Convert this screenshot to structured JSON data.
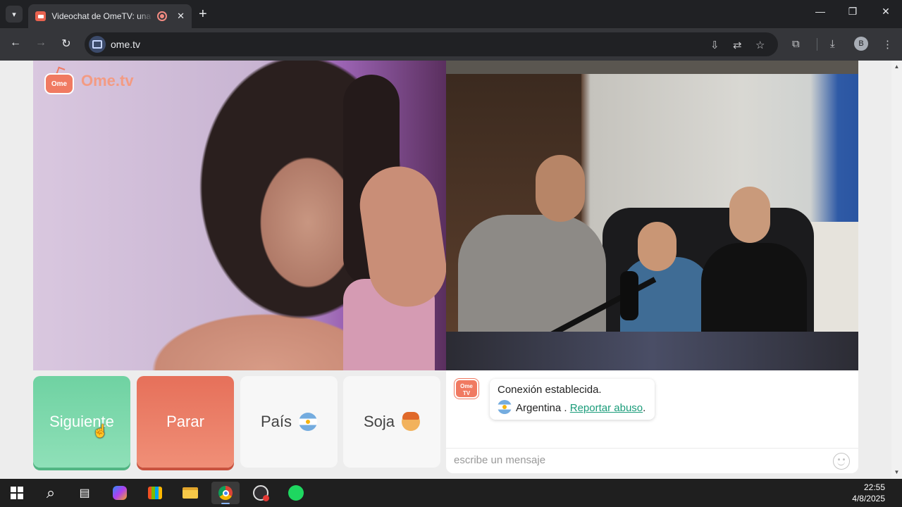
{
  "browser": {
    "tab": {
      "title": "Videochat de OmeTV: una a",
      "close": "✕"
    },
    "new_tab": "+",
    "window_controls": {
      "minimize": "—",
      "maximize": "❐",
      "close": "✕"
    },
    "nav": {
      "back": "←",
      "forward": "→",
      "reload": "↻"
    },
    "url": "ome.tv",
    "profile_initial": "B"
  },
  "page": {
    "logo_text": "Ome.tv",
    "logo_badge": "Ome\nTV",
    "buttons": {
      "next": "Siguiente",
      "stop": "Parar",
      "country": "País",
      "gender": "Soja"
    },
    "chat": {
      "badge": "Ome TV",
      "status": "Conexión establecida.",
      "country": "Argentina",
      "separator": " . ",
      "report_link": "Reportar abuso",
      "report_suffix": ".",
      "input_placeholder": "escribe un mensaje"
    }
  },
  "taskbar": {
    "time": "22:55",
    "date": "4/8/2025",
    "apps": [
      "windows-start",
      "search",
      "task-view",
      "copilot",
      "microsoft-store",
      "file-explorer",
      "chrome",
      "obs",
      "spotify"
    ]
  },
  "colors": {
    "next_button": "#6fd2a2",
    "stop_button": "#e6705a",
    "brand": "#f07a62",
    "link": "#1a9c7a"
  }
}
